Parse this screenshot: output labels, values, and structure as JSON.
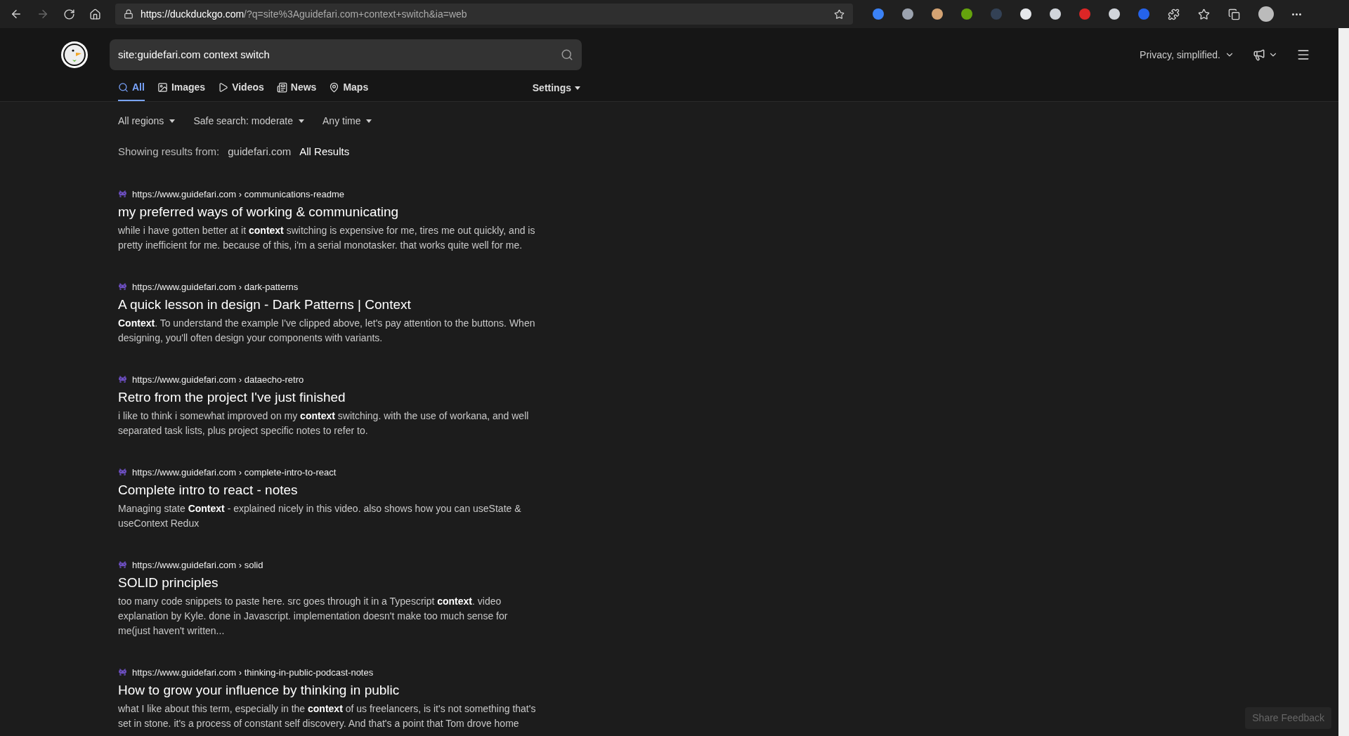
{
  "browser": {
    "url_host": "https://duckduckgo.com",
    "url_rest": "/?q=site%3Aguidefari.com+context+switch&ia=web"
  },
  "search": {
    "value": "site:guidefari.com context switch"
  },
  "tabs": [
    {
      "label": "All",
      "kind": "all",
      "selected": true
    },
    {
      "label": "Images",
      "kind": "images",
      "selected": false
    },
    {
      "label": "Videos",
      "kind": "videos",
      "selected": false
    },
    {
      "label": "News",
      "kind": "news",
      "selected": false
    },
    {
      "label": "Maps",
      "kind": "maps",
      "selected": false
    }
  ],
  "settings": "Settings",
  "tagline": "Privacy, simplified.",
  "filters": [
    "All regions",
    "Safe search: moderate",
    "Any time"
  ],
  "showing": {
    "label": "Showing results from:",
    "site": "guidefari.com",
    "all": "All Results"
  },
  "results": [
    {
      "url": "https://www.guidefari.com › communications-readme",
      "title": "my preferred ways of working & communicating",
      "snippet": "while i have gotten better at it **context** switching is expensive for me, tires me out quickly, and is pretty inefficient for me. because of this, i'm a serial monotasker. that works quite well for me."
    },
    {
      "url": "https://www.guidefari.com › dark-patterns",
      "title": "A quick lesson in design - Dark Patterns | Context",
      "snippet": "**Context**. To understand the example I've clipped above, let's pay attention to the buttons. When designing, you'll often design your components with variants."
    },
    {
      "url": "https://www.guidefari.com › dataecho-retro",
      "title": "Retro from the project I've just finished",
      "snippet": "i like to think i somewhat improved on my **context** switching. with the use of workana, and well separated task lists, plus project specific notes to refer to."
    },
    {
      "url": "https://www.guidefari.com › complete-intro-to-react",
      "title": "Complete intro to react - notes",
      "snippet": "Managing state **Context** - explained nicely in this video. also shows how you can useState & useContext Redux"
    },
    {
      "url": "https://www.guidefari.com › solid",
      "title": "SOLID principles",
      "snippet": "too many code snippets to paste here. src goes through it in a Typescript **context**. video explanation by Kyle. done in Javascript. implementation doesn't make too much sense for me(just haven't written..."
    },
    {
      "url": "https://www.guidefari.com › thinking-in-public-podcast-notes",
      "title": "How to grow your influence by thinking in public",
      "snippet": "what I like about this term, especially in the **context** of us freelancers, is it's not something that's set in stone. it's a process of constant self discovery. And that's a point that Tom drove home"
    }
  ],
  "feedback": "Share Feedback"
}
